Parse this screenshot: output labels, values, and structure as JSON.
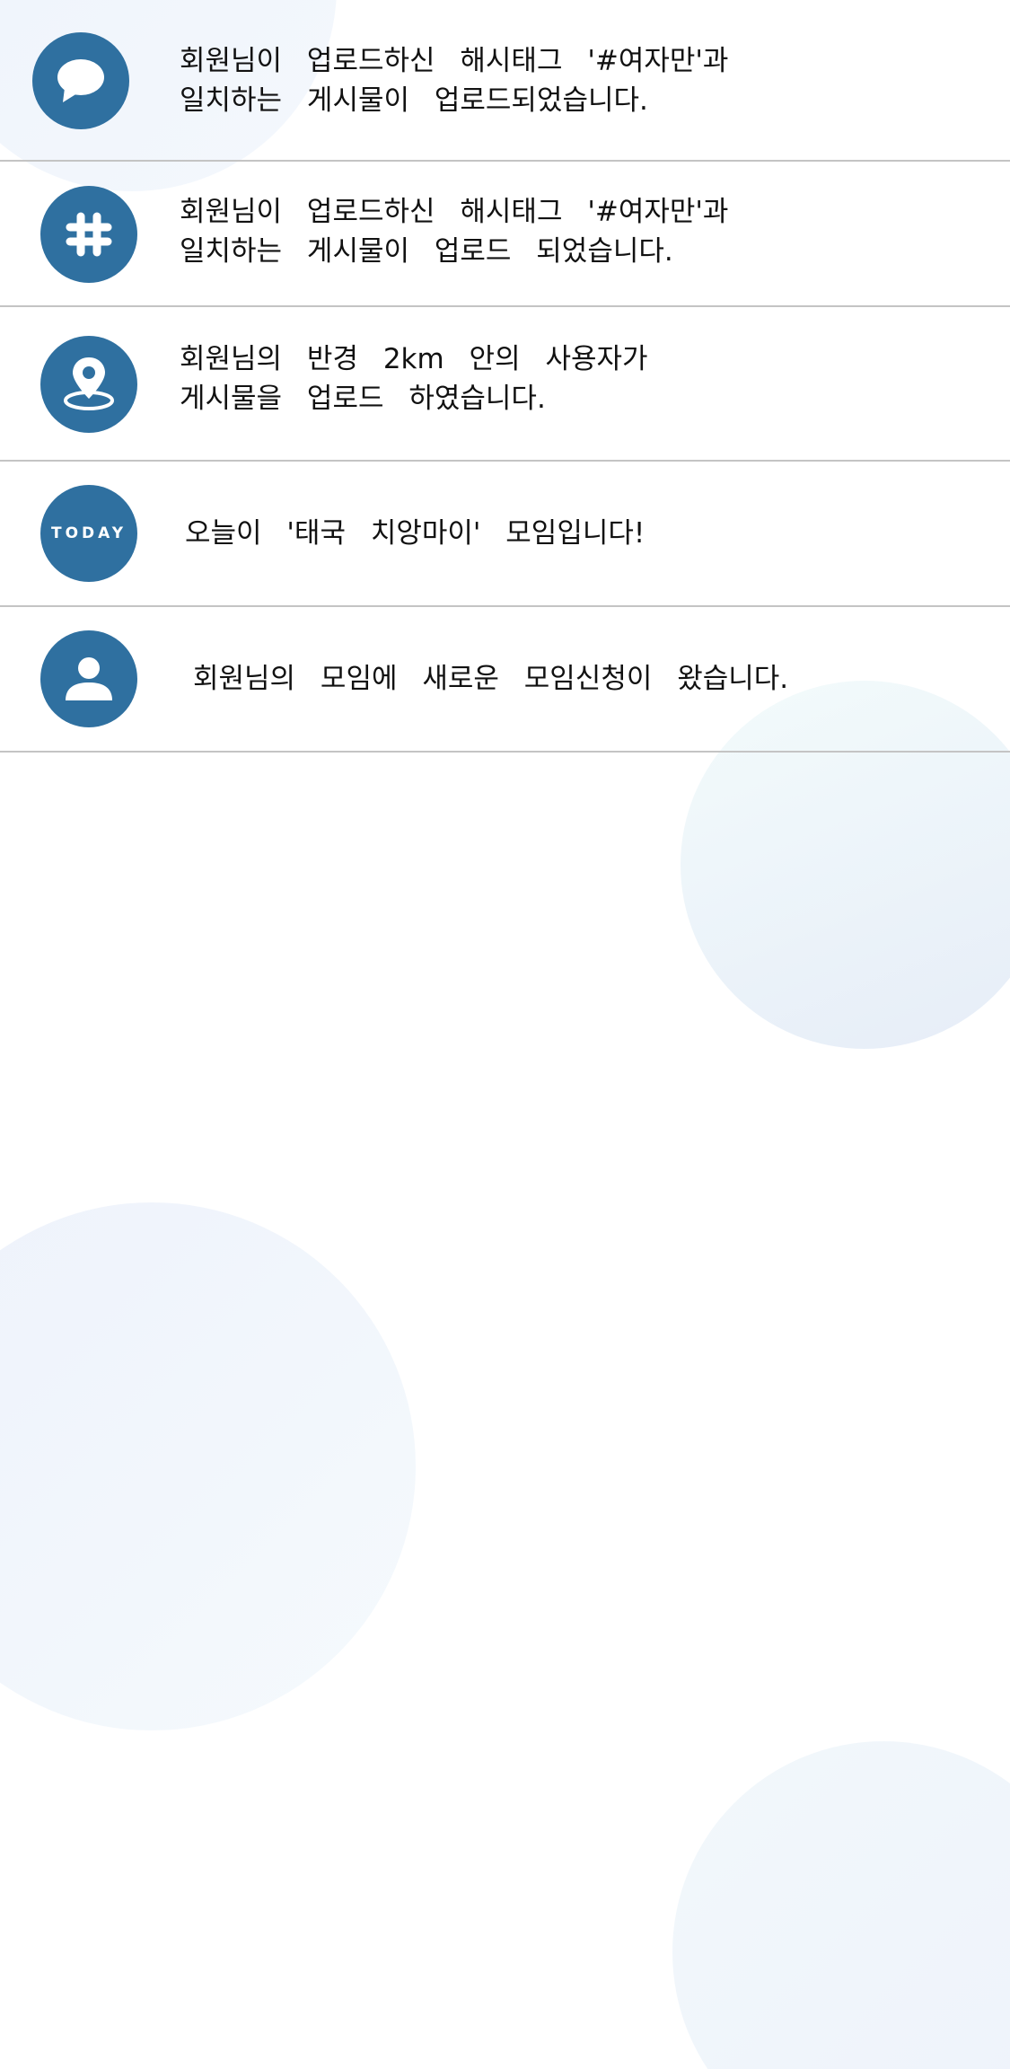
{
  "notifications": [
    {
      "icon": "speech-bubble-icon",
      "line1": "회원님이 업로드하신 해시태그 '#여자만'과",
      "line2": "일치하는 게시물이 업로드되었습니다."
    },
    {
      "icon": "hashtag-icon",
      "line1": "회원님이 업로드하신 해시태그 '#여자만'과",
      "line2": "일치하는 게시물이 업로드 되었습니다."
    },
    {
      "icon": "location-pin-icon",
      "line1": "회원님의 반경 2km 안의 사용자가",
      "line2": "게시물을 업로드 하였습니다."
    },
    {
      "icon": "today-icon",
      "icon_text": "TODAY",
      "line1": "오늘이 '태국 치앙마이' 모임입니다!"
    },
    {
      "icon": "person-icon",
      "line1": "회원님의 모임에 새로운 모임신청이 왔습니다."
    }
  ],
  "colors": {
    "icon_bg": "#2f70a0",
    "divider": "#c4c4c4"
  }
}
